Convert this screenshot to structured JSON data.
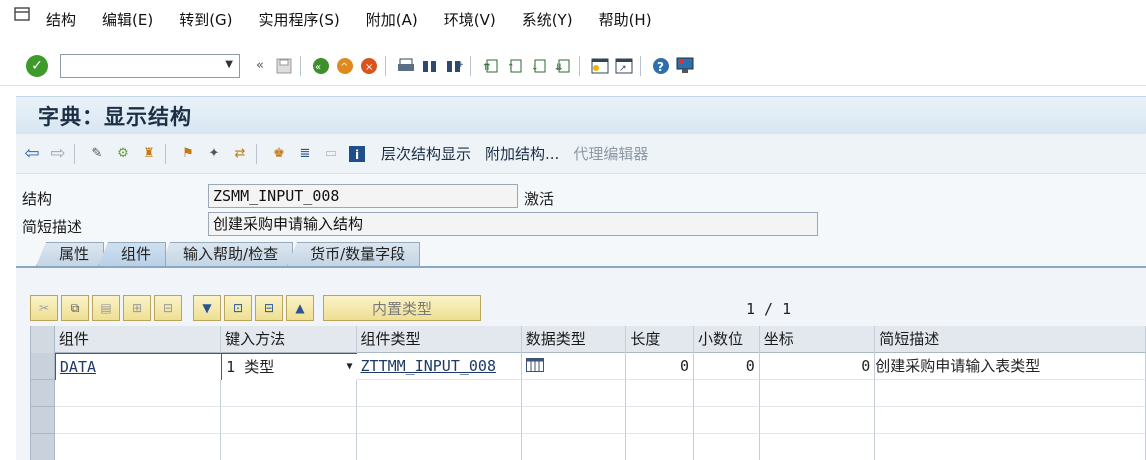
{
  "menu": [
    "结构",
    "编辑(E)",
    "转到(G)",
    "实用程序(S)",
    "附加(A)",
    "环境(V)",
    "系统(Y)",
    "帮助(H)"
  ],
  "title": "字典：显示结构",
  "toolbar": {
    "hierarchy_label": "层次结构显示",
    "append_label": "附加结构...",
    "proxy_label": "代理编辑器"
  },
  "fields": {
    "structure_label": "结构",
    "structure_value": "ZSMM_INPUT_008",
    "status": "激活",
    "desc_label": "简短描述",
    "desc_value": "创建采购申请输入结构"
  },
  "tabs": [
    "属性",
    "组件",
    "输入帮助/检查",
    "货币/数量字段"
  ],
  "active_tab": 1,
  "table_toolbar": {
    "builtin_type_label": "内置类型",
    "page": "1 / 1"
  },
  "table": {
    "headers": [
      "组件",
      "键入方法",
      "组件类型",
      "数据类型",
      "长度",
      "小数位",
      "坐标",
      "简短描述"
    ],
    "rows": [
      {
        "component": "DATA",
        "typing": "1 类型",
        "comptype": "ZTTMM_INPUT_008",
        "datatype_icon": "table-type-icon",
        "length": "0",
        "decimals": "0",
        "coordinate": "0",
        "desc": "创建采购申请输入表类型"
      }
    ]
  },
  "colors": {
    "accent": "#3d9a2b",
    "title_bg": "#d7e6f2"
  }
}
